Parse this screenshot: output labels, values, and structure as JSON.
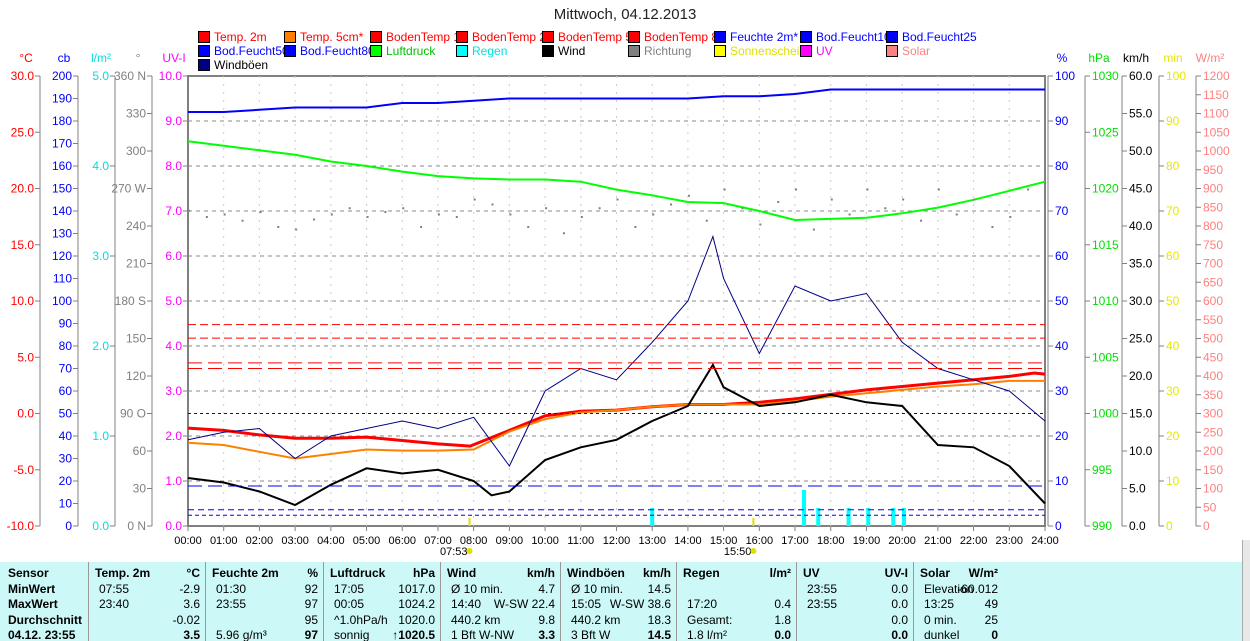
{
  "title": "Mittwoch, 04.12.2013",
  "legend": [
    {
      "label": "Temp. 2m",
      "color": "#ff0000",
      "text": "#ff0000"
    },
    {
      "label": "Temp. 5cm*",
      "color": "#ff8000",
      "text": "#ff0000"
    },
    {
      "label": "BodenTemp 10",
      "color": "#ff0000",
      "text": "#ff0000"
    },
    {
      "label": "BodenTemp 25",
      "color": "#ff0000",
      "text": "#ff0000"
    },
    {
      "label": "BodenTemp 50",
      "color": "#ff0000",
      "text": "#ff0000"
    },
    {
      "label": "BodenTemp 80",
      "color": "#ff0000",
      "text": "#ff0000"
    },
    {
      "label": "Feuchte 2m*",
      "color": "#0000ff",
      "text": "#0000ff"
    },
    {
      "label": "Bod.Feucht10",
      "color": "#0000ff",
      "text": "#0000ff"
    },
    {
      "label": "Bod.Feucht25",
      "color": "#0000ff",
      "text": "#0000ff"
    },
    {
      "label": "Bod.Feucht50",
      "color": "#0000ff",
      "text": "#0000ff"
    },
    {
      "label": "Bod.Feucht80",
      "color": "#0000ff",
      "text": "#0000ff"
    },
    {
      "label": "Luftdruck",
      "color": "#00ff00",
      "text": "#00c000"
    },
    {
      "label": "Regen",
      "color": "#00ffff",
      "text": "#00e0e0"
    },
    {
      "label": "Wind",
      "color": "#000000",
      "text": "#000000"
    },
    {
      "label": "Richtung",
      "color": "#808080",
      "text": "#808080"
    },
    {
      "label": "Sonnenschein",
      "color": "#ffff00",
      "text": "#e0e000"
    },
    {
      "label": "UV",
      "color": "#ff00ff",
      "text": "#ff00ff"
    },
    {
      "label": "Solar",
      "color": "#ff8080",
      "text": "#ff8080"
    },
    {
      "label": "Windböen",
      "color": "#000080",
      "text": "#000000"
    }
  ],
  "chart_data": {
    "type": "line",
    "title": "Mittwoch, 04.12.2013",
    "x_ticks": [
      "00:00",
      "01:00",
      "02:00",
      "03:00",
      "04:00",
      "05:00",
      "06:00",
      "07:00",
      "08:00",
      "09:00",
      "10:00",
      "11:00",
      "12:00",
      "13:00",
      "14:00",
      "15:00",
      "16:00",
      "17:00",
      "18:00",
      "19:00",
      "20:00",
      "21:00",
      "22:00",
      "23:00",
      "24:00"
    ],
    "sunrise": "07:53",
    "sunset": "15:50",
    "left_axes": [
      {
        "unit": "°C",
        "color": "#ff0000",
        "min": -10,
        "max": 30,
        "ticks": [
          "-10.0",
          "-5.0",
          "0.0",
          "5.0",
          "10.0",
          "15.0",
          "20.0",
          "25.0",
          "30.0"
        ]
      },
      {
        "unit": "cb",
        "color": "#0000ff",
        "min": 0,
        "max": 200,
        "ticks": [
          "0",
          "10",
          "20",
          "30",
          "40",
          "50",
          "60",
          "70",
          "80",
          "90",
          "100",
          "110",
          "120",
          "130",
          "140",
          "150",
          "160",
          "170",
          "180",
          "190",
          "200"
        ]
      },
      {
        "unit": "l/m²",
        "color": "#00e0e0",
        "min": 0,
        "max": 5,
        "ticks": [
          "0.0",
          "1.0",
          "2.0",
          "3.0",
          "4.0",
          "5.0"
        ]
      },
      {
        "unit": "°",
        "color": "#808080",
        "min": 0,
        "max": 360,
        "ticks": [
          "0   N",
          "30",
          "60",
          "90  O",
          "120",
          "150",
          "180 S",
          "210",
          "240",
          "270 W",
          "300",
          "330",
          "360 N"
        ]
      },
      {
        "unit": "UV-I",
        "color": "#ff00ff",
        "min": 0,
        "max": 10,
        "ticks": [
          "0.0",
          "1.0",
          "2.0",
          "3.0",
          "4.0",
          "5.0",
          "6.0",
          "7.0",
          "8.0",
          "9.0",
          "10.0"
        ]
      }
    ],
    "right_axes": [
      {
        "unit": "%",
        "color": "#0000ff",
        "min": 0,
        "max": 100,
        "ticks": [
          "0",
          "10",
          "20",
          "30",
          "40",
          "50",
          "60",
          "70",
          "80",
          "90",
          "100"
        ]
      },
      {
        "unit": "hPa",
        "color": "#00e000",
        "min": 990,
        "max": 1030,
        "ticks": [
          "990",
          "995",
          "1000",
          "1005",
          "1010",
          "1015",
          "1020",
          "1025",
          "1030"
        ]
      },
      {
        "unit": "km/h",
        "color": "#000000",
        "min": 0,
        "max": 60,
        "ticks": [
          "0.0",
          "5.0",
          "10.0",
          "15.0",
          "20.0",
          "25.0",
          "30.0",
          "35.0",
          "40.0",
          "45.0",
          "50.0",
          "55.0",
          "60.0"
        ]
      },
      {
        "unit": "min",
        "color": "#e8e800",
        "min": 0,
        "max": 100,
        "ticks": [
          "0",
          "10",
          "20",
          "30",
          "40",
          "50",
          "60",
          "70",
          "80",
          "90",
          "100"
        ]
      },
      {
        "unit": "W/m²",
        "color": "#ff8080",
        "min": 0,
        "max": 1200,
        "ticks": [
          "0",
          "50",
          "100",
          "150",
          "200",
          "250",
          "300",
          "350",
          "400",
          "450",
          "500",
          "550",
          "600",
          "650",
          "700",
          "750",
          "800",
          "850",
          "900",
          "950",
          "1000",
          "1050",
          "1100",
          "1150",
          "1200"
        ]
      }
    ],
    "series": [
      {
        "name": "Feuchte 2m*",
        "axis": "%",
        "color": "#0000ff",
        "width": 2,
        "x": [
          0,
          1,
          2,
          3,
          4,
          5,
          6,
          7,
          8,
          9,
          10,
          11,
          12,
          13,
          14,
          15,
          16,
          17,
          18,
          19,
          20,
          21,
          22,
          23,
          24
        ],
        "y": [
          92,
          92,
          92.5,
          93,
          93,
          93,
          94,
          94,
          94.5,
          95,
          95,
          95,
          95,
          95,
          95,
          95.5,
          95.5,
          96,
          97,
          97,
          97,
          97,
          97,
          97,
          97
        ]
      },
      {
        "name": "Luftdruck",
        "axis": "hPa",
        "color": "#00ff00",
        "width": 2,
        "x": [
          0,
          1,
          2,
          3,
          4,
          5,
          6,
          7,
          8,
          9,
          10,
          11,
          12,
          13,
          14,
          15,
          16,
          17,
          18,
          19,
          20,
          21,
          22,
          23,
          24
        ],
        "y": [
          1024.2,
          1023.8,
          1023.4,
          1023.0,
          1022.4,
          1022.0,
          1021.5,
          1021.1,
          1020.9,
          1020.8,
          1020.8,
          1020.6,
          1019.9,
          1019.4,
          1018.8,
          1018.7,
          1018.0,
          1017.2,
          1017.3,
          1017.4,
          1017.8,
          1018.3,
          1019.0,
          1019.8,
          1020.6
        ]
      },
      {
        "name": "Temp. 2m",
        "axis": "°C",
        "color": "#ff0000",
        "width": 3,
        "x": [
          0,
          1,
          2,
          3,
          4,
          5,
          6,
          7,
          7.9,
          9,
          10,
          11,
          12,
          13,
          14,
          15,
          16,
          17,
          18,
          19,
          20,
          21,
          22,
          23,
          23.7,
          24
        ],
        "y": [
          -1.3,
          -1.5,
          -1.9,
          -2.2,
          -2.2,
          -2.1,
          -2.4,
          -2.7,
          -2.9,
          -1.5,
          -0.2,
          0.2,
          0.3,
          0.6,
          0.8,
          0.8,
          1.0,
          1.3,
          1.7,
          2.1,
          2.4,
          2.7,
          3.0,
          3.3,
          3.6,
          3.5
        ]
      },
      {
        "name": "Temp. 5cm*",
        "axis": "°C",
        "color": "#ff8000",
        "width": 2,
        "x": [
          0,
          1,
          2,
          3,
          4,
          5,
          6,
          7,
          8,
          9,
          10,
          11,
          12,
          13,
          14,
          15,
          16,
          17,
          18,
          19,
          20,
          21,
          22,
          23,
          24
        ],
        "y": [
          -2.6,
          -2.8,
          -3.4,
          -4.0,
          -3.6,
          -3.2,
          -3.3,
          -3.3,
          -3.2,
          -1.6,
          -0.5,
          0.1,
          0.3,
          0.6,
          0.8,
          0.8,
          0.8,
          1.1,
          1.5,
          1.8,
          2.1,
          2.4,
          2.6,
          2.9,
          2.9
        ]
      },
      {
        "name": "Wind",
        "axis": "km/h",
        "color": "#000000",
        "width": 2,
        "x": [
          0,
          1,
          2,
          3,
          4,
          5,
          6,
          7,
          8,
          8.5,
          9,
          10,
          11,
          12,
          13,
          14,
          14.7,
          15,
          16,
          17,
          18,
          19,
          20,
          21,
          22,
          23,
          24
        ],
        "y": [
          6.4,
          5.8,
          4.6,
          2.8,
          5.5,
          7.7,
          7.0,
          7.5,
          6.0,
          4.1,
          4.6,
          8.8,
          10.5,
          11.5,
          14.0,
          16.0,
          21.5,
          18.5,
          16.0,
          16.5,
          17.5,
          16.5,
          16.0,
          10.8,
          10.5,
          8.0,
          3.0
        ]
      },
      {
        "name": "Windböen",
        "axis": "km/h",
        "color": "#000080",
        "width": 1,
        "x": [
          0,
          1,
          2,
          3,
          4,
          5,
          6,
          7,
          8,
          9,
          10,
          11,
          12,
          13,
          14,
          14.7,
          15,
          16,
          17,
          18,
          19,
          20,
          21,
          22,
          23,
          24
        ],
        "y": [
          11.5,
          12.5,
          13,
          9,
          12,
          13,
          14,
          13,
          14.5,
          8,
          18,
          21,
          19.5,
          24.5,
          30,
          38.6,
          33,
          23,
          32,
          30,
          31,
          24.5,
          21,
          19.5,
          18,
          14
        ]
      },
      {
        "name": "Richtung",
        "axis": "°",
        "color": "#808080",
        "type": "scatter",
        "x": [
          0,
          0.5,
          1,
          1.5,
          2,
          2.5,
          3,
          3.5,
          4,
          4.5,
          5,
          5.5,
          6,
          6.5,
          7,
          7.5,
          8,
          8.5,
          9,
          9.5,
          10,
          10.5,
          11,
          11.5,
          12,
          12.5,
          13,
          13.5,
          14,
          14.5,
          15,
          15.5,
          16,
          16.5,
          17,
          17.5,
          18,
          18.5,
          19,
          19.5,
          20,
          20.5,
          21,
          21.5,
          22,
          22.5,
          23,
          23.5
        ],
        "y": [
          253,
          248,
          250,
          245,
          252,
          240,
          238,
          246,
          250,
          255,
          248,
          252,
          255,
          240,
          250,
          248,
          262,
          258,
          250,
          240,
          255,
          235,
          248,
          255,
          262,
          240,
          250,
          258,
          265,
          245,
          270,
          255,
          242,
          260,
          270,
          238,
          262,
          250,
          270,
          255,
          262,
          245,
          270,
          250,
          262,
          240,
          248,
          270
        ]
      },
      {
        "name": "BodenTemp 10",
        "axis": "°C",
        "color": "#ff0000",
        "dash": "8,4",
        "const": 7.9
      },
      {
        "name": "BodenTemp 25",
        "axis": "°C",
        "color": "#ff0000",
        "dash": "8,4",
        "const": 6.7
      },
      {
        "name": "BodenTemp 50",
        "axis": "°C",
        "color": "#ff0000",
        "dash": "14,6",
        "const": 4.5
      },
      {
        "name": "BodenTemp 80",
        "axis": "°C",
        "color": "#ff0000",
        "dash": "14,6",
        "const": 4.0
      },
      {
        "name": "Bod.Feucht10",
        "axis": "%",
        "color": "#0000ff",
        "dash": "3,3",
        "const": 25
      },
      {
        "name": "Bod.Feucht25",
        "axis": "%",
        "color": "#0000ff",
        "dash": "14,6",
        "const": 8.9
      },
      {
        "name": "Bod.Feucht50",
        "axis": "%",
        "color": "#0000ff",
        "dash": "6,4",
        "const": 3.6
      },
      {
        "name": "Bod.Feucht80",
        "axis": "%",
        "color": "#0000ff",
        "dash": "4,3",
        "const": 2.4
      }
    ],
    "rain": {
      "axis": "l/m²",
      "color": "#00ffff",
      "x": [
        13.0,
        17.25,
        17.65,
        18.5,
        19.05,
        19.75,
        20.05
      ],
      "y": [
        0.2,
        0.4,
        0.2,
        0.2,
        0.2,
        0.2,
        0.2
      ]
    }
  },
  "table": {
    "columns": [
      {
        "rows": [
          [
            "Sensor",
            ""
          ],
          [
            "MinWert",
            ""
          ],
          [
            "MaxWert",
            ""
          ],
          [
            "Durchschnitt",
            ""
          ],
          [
            "04.12. 23:55",
            ""
          ]
        ],
        "boldLeft": true
      },
      {
        "rows": [
          [
            "Temp. 2m",
            "°C"
          ],
          [
            "07:55",
            "-2.9"
          ],
          [
            "23:40",
            "3.6"
          ],
          [
            "",
            "-0.02"
          ],
          [
            "",
            "3.5"
          ]
        ]
      },
      {
        "rows": [
          [
            "Feuchte 2m",
            "%"
          ],
          [
            "01:30",
            "92"
          ],
          [
            "23:55",
            "97"
          ],
          [
            "",
            "95"
          ],
          [
            "5.96 g/m³",
            "97"
          ]
        ]
      },
      {
        "rows": [
          [
            "Luftdruck",
            "hPa"
          ],
          [
            "17:05",
            "1017.0"
          ],
          [
            "00:05",
            "1024.2"
          ],
          [
            "^1.0hPa/h",
            "1020.0"
          ],
          [
            "sonnig",
            "↑1020.5"
          ]
        ]
      },
      {
        "rows": [
          [
            "Wind",
            "km/h"
          ],
          [
            "Ø 10 min.",
            "4.7"
          ],
          [
            "14:40",
            "W-SW 22.4"
          ],
          [
            "440.2 km",
            "9.8"
          ],
          [
            "1 Bft W-NW",
            "3.3"
          ]
        ]
      },
      {
        "rows": [
          [
            "Windböen",
            "km/h"
          ],
          [
            "Ø 10 min.",
            "14.5"
          ],
          [
            "15:05",
            "W-SW 38.6"
          ],
          [
            "440.2 km",
            "18.3"
          ],
          [
            "3 Bft W",
            "14.5"
          ]
        ]
      },
      {
        "rows": [
          [
            "Regen",
            "l/m²"
          ],
          [
            "",
            ""
          ],
          [
            "17:20",
            "0.4"
          ],
          [
            "Gesamt:",
            "1.8"
          ],
          [
            "1.8 l/m²",
            "0.0"
          ]
        ]
      },
      {
        "rows": [
          [
            "UV",
            "UV-I"
          ],
          [
            "23:55",
            "0.0"
          ],
          [
            "23:55",
            "0.0"
          ],
          [
            "",
            "0.0"
          ],
          [
            "",
            "0.0"
          ]
        ]
      },
      {
        "rows": [
          [
            "Solar",
            "W/m²"
          ],
          [
            "Elevation",
            "-60.012"
          ],
          [
            "13:25",
            "49"
          ],
          [
            "0 min.",
            "25"
          ],
          [
            "dunkel",
            "0"
          ]
        ]
      }
    ]
  }
}
